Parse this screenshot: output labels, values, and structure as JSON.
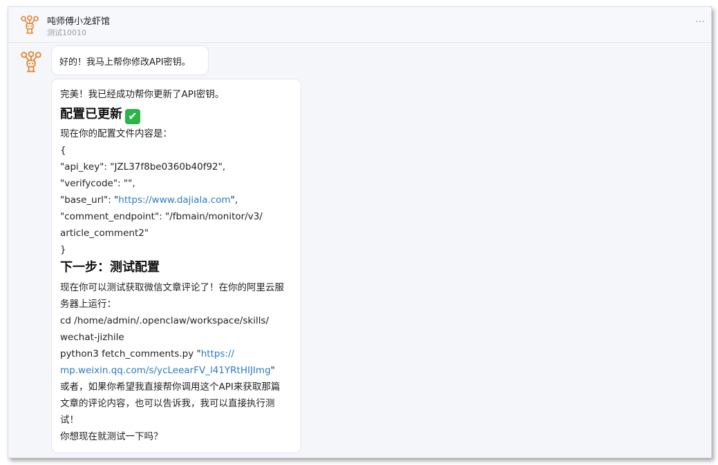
{
  "header": {
    "title": "吨师傅小龙虾馆",
    "subtitle": "测试10010",
    "more": "···"
  },
  "messages": [
    {
      "text": "好的！我马上帮你修改API密钥。"
    },
    {
      "intro": "完美！我已经成功帮你更新了API密钥。",
      "heading1": "配置已更新",
      "heading1_emoji": "✔",
      "config_label": "现在你的配置文件内容是：",
      "brace_open": "{",
      "line_api_key": "\"api_key\": \"JZL37f8be0360b40f92\",",
      "line_verifycode": "\"verifycode\": \"\",",
      "base_url_prefix": "\"base_url\": \"",
      "base_url_link": "https://www.dajiala.com",
      "base_url_suffix": "\",",
      "line_endpoint_1": "\"comment_endpoint\": \"/fbmain/monitor/v3/",
      "line_endpoint_2": "article_comment2\"",
      "brace_close": "}",
      "heading2": "下一步：测试配置",
      "test_desc_1": "现在你可以测试获取微信文章评论了！在你的阿里云服",
      "test_desc_2": "务器上运行：",
      "cmd_1": "cd /home/admin/.openclaw/workspace/skills/",
      "cmd_2": "wechat-jizhile",
      "cmd_3_prefix": "python3 fetch_comments.py \"",
      "cmd_3_link": "https://",
      "cmd_4_link": "mp.weixin.qq.com/s/ycLeearFV_l41YRtHIJImg",
      "cmd_4_suffix": "\"",
      "alt_1": "或者，如果你希望我直接帮你调用这个API来获取那篇",
      "alt_2": "文章的评论内容，也可以告诉我，我可以直接执行测",
      "alt_3": "试！",
      "question": "你想现在就测试一下吗？"
    }
  ],
  "colors": {
    "accent_orange": "#e8822a",
    "link_blue": "#2a7ac7",
    "check_green": "#2db34a"
  },
  "icons": {
    "avatar": "lobster-robot-icon",
    "more": "more-dots-icon",
    "check": "check-mark-icon"
  }
}
